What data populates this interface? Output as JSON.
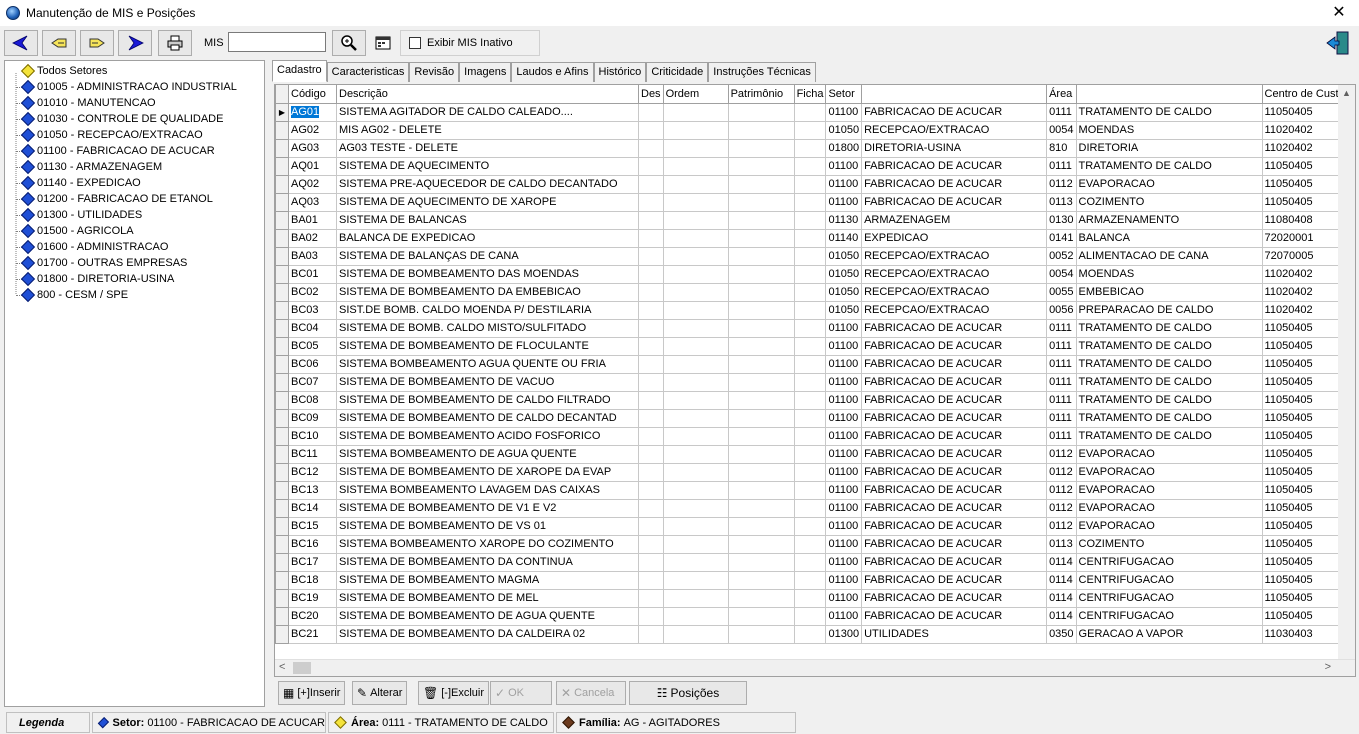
{
  "window": {
    "title": "Manutenção de MIS e Posições",
    "close_glyph": "✕"
  },
  "toolbar": {
    "mis_label": "MIS",
    "mis_value": "",
    "show_inactive_label": "Exibir MIS Inativo",
    "show_inactive_checked": false
  },
  "tree": {
    "root": "Todos Setores",
    "items": [
      "01005 - ADMINISTRACAO INDUSTRIAL",
      "01010 - MANUTENCAO",
      "01030 - CONTROLE DE QUALIDADE",
      "01050 - RECEPCAO/EXTRACAO",
      "01100 - FABRICACAO DE ACUCAR",
      "01130 - ARMAZENAGEM",
      "01140 - EXPEDICAO",
      "01200 - FABRICACAO DE ETANOL",
      "01300 - UTILIDADES",
      "01500 - AGRICOLA",
      "01600 - ADMINISTRACAO",
      "01700 - OUTRAS EMPRESAS",
      "01800 - DIRETORIA-USINA",
      "800 - CESM / SPE"
    ]
  },
  "tabs": [
    "Cadastro",
    "Caracteristicas",
    "Revisão",
    "Imagens",
    "Laudos e Afins",
    "Histórico",
    "Criticidade",
    "Instruções Técnicas"
  ],
  "grid": {
    "columns": [
      "Código",
      "Descrição",
      "Des",
      "Ordem",
      "Patrimônio",
      "Ficha",
      "Setor",
      "",
      "Área",
      "",
      "Centro de Custo"
    ],
    "rows": [
      [
        "AG01",
        "SISTEMA AGITADOR DE CALDO CALEADO....",
        "",
        "",
        "",
        "",
        "01100",
        "FABRICACAO DE ACUCAR",
        "0111",
        "TRATAMENTO DE CALDO",
        "11050405"
      ],
      [
        "AG02",
        "MIS AG02 - DELETE",
        "",
        "",
        "",
        "",
        "01050",
        "RECEPCAO/EXTRACAO",
        "0054",
        "MOENDAS",
        "11020402"
      ],
      [
        "AG03",
        "AG03 TESTE - DELETE",
        "",
        "",
        "",
        "",
        "01800",
        "DIRETORIA-USINA",
        "810",
        "DIRETORIA",
        "11020402"
      ],
      [
        "AQ01",
        "SISTEMA DE AQUECIMENTO",
        "",
        "",
        "",
        "",
        "01100",
        "FABRICACAO DE ACUCAR",
        "0111",
        "TRATAMENTO DE CALDO",
        "11050405"
      ],
      [
        "AQ02",
        "SISTEMA PRE-AQUECEDOR DE CALDO DECANTADO",
        "",
        "",
        "",
        "",
        "01100",
        "FABRICACAO DE ACUCAR",
        "0112",
        "EVAPORACAO",
        "11050405"
      ],
      [
        "AQ03",
        "SISTEMA DE AQUECIMENTO DE XAROPE",
        "",
        "",
        "",
        "",
        "01100",
        "FABRICACAO DE ACUCAR",
        "0113",
        "COZIMENTO",
        "11050405"
      ],
      [
        "BA01",
        "SISTEMA DE BALANCAS",
        "",
        "",
        "",
        "",
        "01130",
        "ARMAZENAGEM",
        "0130",
        "ARMAZENAMENTO",
        "11080408"
      ],
      [
        "BA02",
        "BALANCA DE EXPEDICAO",
        "",
        "",
        "",
        "",
        "01140",
        "EXPEDICAO",
        "0141",
        "BALANCA",
        "72020001"
      ],
      [
        "BA03",
        "SISTEMA DE BALANÇAS DE CANA",
        "",
        "",
        "",
        "",
        "01050",
        "RECEPCAO/EXTRACAO",
        "0052",
        "ALIMENTACAO DE CANA",
        "72070005"
      ],
      [
        "BC01",
        "SISTEMA DE BOMBEAMENTO DAS MOENDAS",
        "",
        "",
        "",
        "",
        "01050",
        "RECEPCAO/EXTRACAO",
        "0054",
        "MOENDAS",
        "11020402"
      ],
      [
        "BC02",
        "SISTEMA DE BOMBEAMENTO DA EMBEBICAO",
        "",
        "",
        "",
        "",
        "01050",
        "RECEPCAO/EXTRACAO",
        "0055",
        "EMBEBICAO",
        "11020402"
      ],
      [
        "BC03",
        "SIST.DE BOMB. CALDO MOENDA P/ DESTILARIA",
        "",
        "",
        "",
        "",
        "01050",
        "RECEPCAO/EXTRACAO",
        "0056",
        "PREPARACAO DE CALDO",
        "11020402"
      ],
      [
        "BC04",
        "SISTEMA DE BOMB. CALDO MISTO/SULFITADO",
        "",
        "",
        "",
        "",
        "01100",
        "FABRICACAO DE ACUCAR",
        "0111",
        "TRATAMENTO DE CALDO",
        "11050405"
      ],
      [
        "BC05",
        "SISTEMA DE BOMBEAMENTO DE FLOCULANTE",
        "",
        "",
        "",
        "",
        "01100",
        "FABRICACAO DE ACUCAR",
        "0111",
        "TRATAMENTO DE CALDO",
        "11050405"
      ],
      [
        "BC06",
        "SISTEMA BOMBEAMENTO AGUA QUENTE OU FRIA",
        "",
        "",
        "",
        "",
        "01100",
        "FABRICACAO DE ACUCAR",
        "0111",
        "TRATAMENTO DE CALDO",
        "11050405"
      ],
      [
        "BC07",
        "SISTEMA DE BOMBEAMENTO DE VACUO",
        "",
        "",
        "",
        "",
        "01100",
        "FABRICACAO DE ACUCAR",
        "0111",
        "TRATAMENTO DE CALDO",
        "11050405"
      ],
      [
        "BC08",
        "SISTEMA DE BOMBEAMENTO DE CALDO FILTRADO",
        "",
        "",
        "",
        "",
        "01100",
        "FABRICACAO DE ACUCAR",
        "0111",
        "TRATAMENTO DE CALDO",
        "11050405"
      ],
      [
        "BC09",
        "SISTEMA DE BOMBEAMENTO DE CALDO DECANTAD",
        "",
        "",
        "",
        "",
        "01100",
        "FABRICACAO DE ACUCAR",
        "0111",
        "TRATAMENTO DE CALDO",
        "11050405"
      ],
      [
        "BC10",
        "SISTEMA DE BOMBEAMENTO ACIDO FOSFORICO",
        "",
        "",
        "",
        "",
        "01100",
        "FABRICACAO DE ACUCAR",
        "0111",
        "TRATAMENTO DE CALDO",
        "11050405"
      ],
      [
        "BC11",
        "SISTEMA BOMBEAMENTO DE AGUA QUENTE",
        "",
        "",
        "",
        "",
        "01100",
        "FABRICACAO DE ACUCAR",
        "0112",
        "EVAPORACAO",
        "11050405"
      ],
      [
        "BC12",
        "SISTEMA DE BOMBEAMENTO DE XAROPE DA EVAP",
        "",
        "",
        "",
        "",
        "01100",
        "FABRICACAO DE ACUCAR",
        "0112",
        "EVAPORACAO",
        "11050405"
      ],
      [
        "BC13",
        "SISTEMA BOMBEAMENTO LAVAGEM DAS CAIXAS",
        "",
        "",
        "",
        "",
        "01100",
        "FABRICACAO DE ACUCAR",
        "0112",
        "EVAPORACAO",
        "11050405"
      ],
      [
        "BC14",
        "SISTEMA DE BOMBEAMENTO DE V1 E V2",
        "",
        "",
        "",
        "",
        "01100",
        "FABRICACAO DE ACUCAR",
        "0112",
        "EVAPORACAO",
        "11050405"
      ],
      [
        "BC15",
        "SISTEMA DE BOMBEAMENTO DE VS 01",
        "",
        "",
        "",
        "",
        "01100",
        "FABRICACAO DE ACUCAR",
        "0112",
        "EVAPORACAO",
        "11050405"
      ],
      [
        "BC16",
        "SISTEMA BOMBEAMENTO XAROPE DO COZIMENTO",
        "",
        "",
        "",
        "",
        "01100",
        "FABRICACAO DE ACUCAR",
        "0113",
        "COZIMENTO",
        "11050405"
      ],
      [
        "BC17",
        "SISTEMA DE BOMBEAMENTO DA CONTINUA",
        "",
        "",
        "",
        "",
        "01100",
        "FABRICACAO DE ACUCAR",
        "0114",
        "CENTRIFUGACAO",
        "11050405"
      ],
      [
        "BC18",
        "SISTEMA DE BOMBEAMENTO MAGMA",
        "",
        "",
        "",
        "",
        "01100",
        "FABRICACAO DE ACUCAR",
        "0114",
        "CENTRIFUGACAO",
        "11050405"
      ],
      [
        "BC19",
        "SISTEMA DE BOMBEAMENTO DE MEL",
        "",
        "",
        "",
        "",
        "01100",
        "FABRICACAO DE ACUCAR",
        "0114",
        "CENTRIFUGACAO",
        "11050405"
      ],
      [
        "BC20",
        "SISTEMA DE BOMBEAMENTO DE AGUA QUENTE",
        "",
        "",
        "",
        "",
        "01100",
        "FABRICACAO DE ACUCAR",
        "0114",
        "CENTRIFUGACAO",
        "11050405"
      ],
      [
        "BC21",
        "SISTEMA DE BOMBEAMENTO DA CALDEIRA 02",
        "",
        "",
        "",
        "",
        "01300",
        "UTILIDADES",
        "0350",
        "GERACAO A VAPOR",
        "11030403"
      ]
    ]
  },
  "buttons": {
    "inserir": "[+]Inserir",
    "alterar": "Alterar",
    "excluir": "[-]Excluir",
    "ok": "OK",
    "cancela": "Cancela",
    "posicoes": "Posições"
  },
  "status": {
    "legend": "Legenda",
    "setor_label": "Setor:",
    "setor_value": "01100 - FABRICACAO DE ACUCAR",
    "area_label": "Área:",
    "area_value": "0111 - TRATAMENTO DE CALDO",
    "familia_label": "Família:",
    "familia_value": "AG - AGITADORES"
  }
}
